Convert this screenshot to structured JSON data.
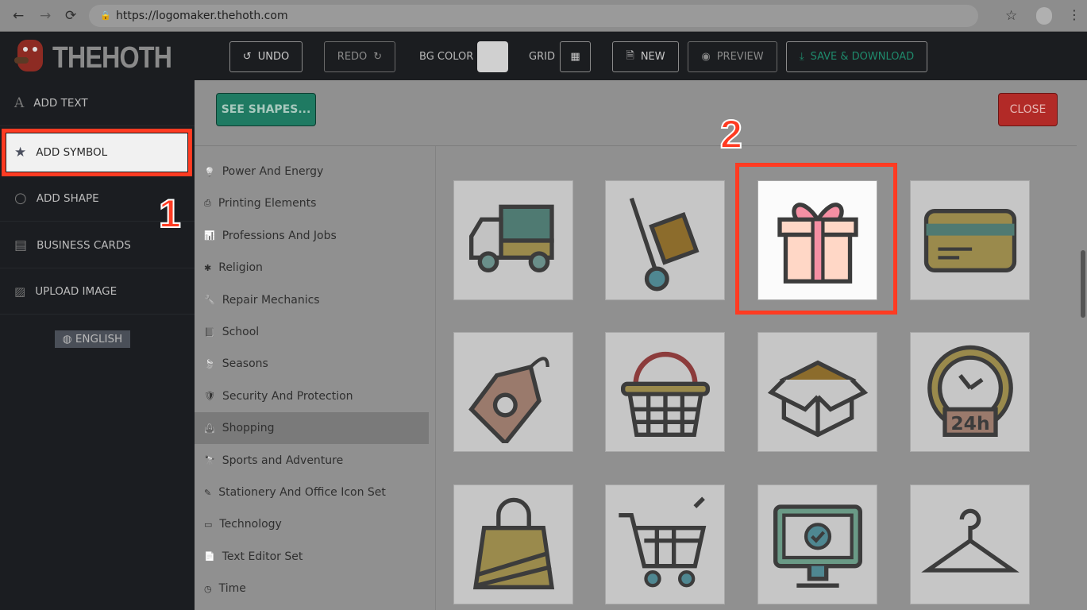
{
  "browser": {
    "url": "https://logomaker.thehoth.com",
    "back": "←",
    "forward": "→",
    "reload": "⟳"
  },
  "header": {
    "logo": "THEHOTH",
    "undo": "UNDO",
    "redo": "REDO",
    "bg_color": "BG COLOR",
    "grid": "GRID",
    "new": "NEW",
    "preview": "PREVIEW",
    "save": "SAVE & DOWNLOAD",
    "bg_swatch": "#d0d0d0"
  },
  "sidebar": {
    "items": [
      {
        "label": "ADD TEXT",
        "icon": "A"
      },
      {
        "label": "ADD SYMBOL",
        "icon": "★"
      },
      {
        "label": "ADD SHAPE",
        "icon": "○"
      },
      {
        "label": "BUSINESS CARDS",
        "icon": "▤"
      },
      {
        "label": "UPLOAD IMAGE",
        "icon": "▨"
      }
    ],
    "language": "ENGLISH"
  },
  "panel": {
    "see_shapes": "SEE SHAPES...",
    "close": "CLOSE",
    "categories": [
      {
        "label": "Power And Energy",
        "icon": "💡"
      },
      {
        "label": "Printing Elements",
        "icon": "⎙"
      },
      {
        "label": "Professions And Jobs",
        "icon": "📊"
      },
      {
        "label": "Religion",
        "icon": "✱"
      },
      {
        "label": "Repair Mechanics",
        "icon": "🔧"
      },
      {
        "label": "School",
        "icon": "📘"
      },
      {
        "label": "Seasons",
        "icon": "🍃"
      },
      {
        "label": "Security And Protection",
        "icon": "🛡"
      },
      {
        "label": "Shopping",
        "icon": "👜",
        "selected": true
      },
      {
        "label": "Sports and Adventure",
        "icon": "🔭"
      },
      {
        "label": "Stationery And Office Icon Set",
        "icon": "✎"
      },
      {
        "label": "Technology",
        "icon": "▭"
      },
      {
        "label": "Text Editor Set",
        "icon": "📄"
      },
      {
        "label": "Time",
        "icon": "◷"
      }
    ],
    "symbols": [
      "delivery-truck",
      "hand-truck",
      "gift-box",
      "credit-card",
      "price-tag",
      "basket",
      "open-box",
      "24h-clock",
      "shopping-bag",
      "shopping-cart",
      "monitor-check",
      "hanger"
    ]
  },
  "annotations": {
    "step1": "1",
    "step2": "2"
  },
  "colors": {
    "accent_green": "#1d7a63",
    "close_red": "#b52a28",
    "highlight_red": "#ff3b22"
  }
}
